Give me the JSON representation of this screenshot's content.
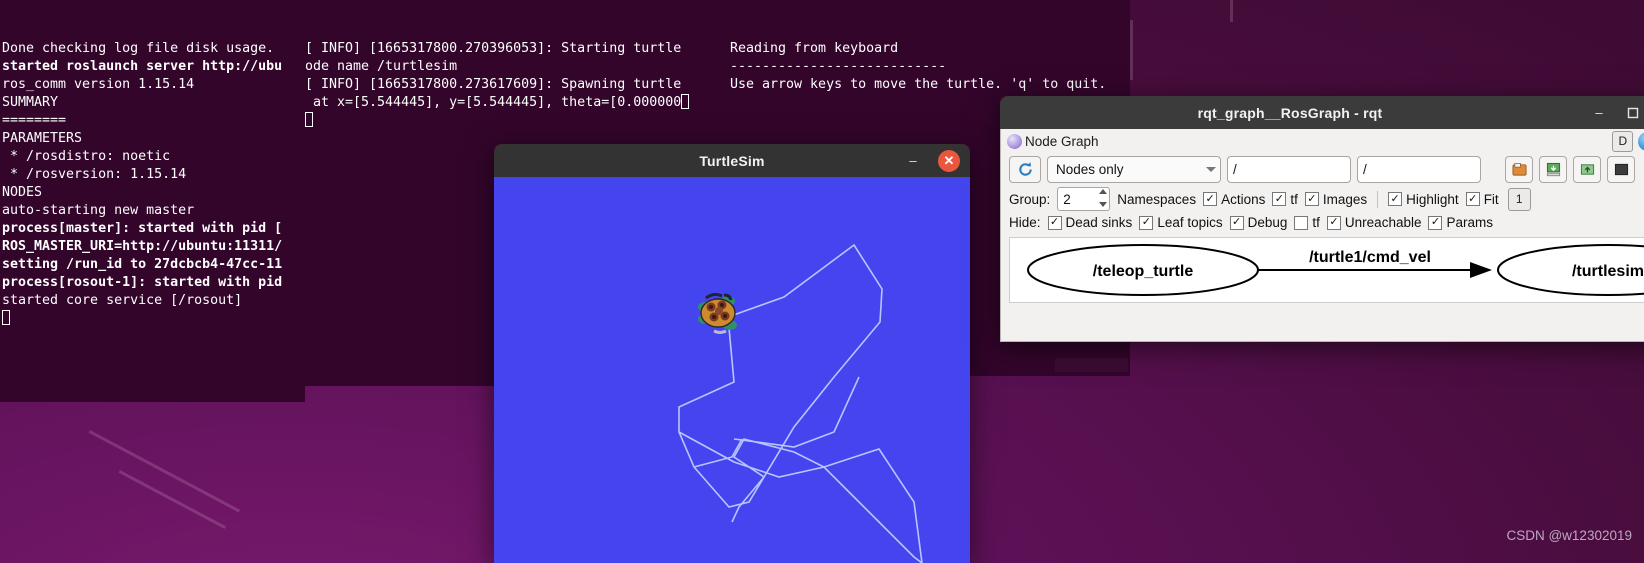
{
  "desktop": {
    "watermark": "CSDN @w12302019"
  },
  "terminals": [
    {
      "id": "roscore-terminal",
      "lines": [
        {
          "text": "Done checking log file disk usage.",
          "bold": false
        },
        {
          "text": "",
          "bold": false
        },
        {
          "text": "started roslaunch server http://ubu",
          "bold": true
        },
        {
          "text": "ros_comm version 1.15.14",
          "bold": false
        },
        {
          "text": "",
          "bold": false
        },
        {
          "text": "",
          "bold": false
        },
        {
          "text": "SUMMARY",
          "bold": false
        },
        {
          "text": "========",
          "bold": false
        },
        {
          "text": "",
          "bold": false
        },
        {
          "text": "PARAMETERS",
          "bold": false
        },
        {
          "text": " * /rosdistro: noetic",
          "bold": false
        },
        {
          "text": " * /rosversion: 1.15.14",
          "bold": false
        },
        {
          "text": "",
          "bold": false
        },
        {
          "text": "NODES",
          "bold": false
        },
        {
          "text": "",
          "bold": false
        },
        {
          "text": "auto-starting new master",
          "bold": false
        },
        {
          "text": "process[master]: started with pid [",
          "bold": true
        },
        {
          "text": "ROS_MASTER_URI=http://ubuntu:11311/",
          "bold": true
        },
        {
          "text": "",
          "bold": false
        },
        {
          "text": "setting /run_id to 27dcbcb4-47cc-11",
          "bold": true
        },
        {
          "text": "process[rosout-1]: started with pid",
          "bold": true
        },
        {
          "text": "started core service [/rosout]",
          "bold": false
        }
      ]
    },
    {
      "id": "turtlesim-node-terminal",
      "lines": [
        {
          "text": "[ INFO] [1665317800.270396053]: Starting turtle",
          "bold": false
        },
        {
          "text": "ode name /turtlesim",
          "bold": false
        },
        {
          "text": "[ INFO] [1665317800.273617609]: Spawning turtle",
          "bold": false
        },
        {
          "text": " at x=[5.544445], y=[5.544445], theta=[0.000000",
          "bold": false
        }
      ]
    },
    {
      "id": "teleop-key-terminal",
      "lines": [
        {
          "text": "Reading from keyboard",
          "bold": false
        },
        {
          "text": "---------------------------",
          "bold": false
        },
        {
          "text": "Use arrow keys to move the turtle. 'q' to quit.",
          "bold": false
        }
      ]
    }
  ],
  "turtlesim": {
    "title": "TurtleSim",
    "minimize_label": "–",
    "close_label": "✕",
    "canvas_color": "#4545f0",
    "path_color": "#b6c6ff"
  },
  "rqt": {
    "title": "rqt_graph__RosGraph - rqt",
    "minimize_label": "–",
    "maximize_label": "❑",
    "close_label": "✕",
    "dock": {
      "title": "Node Graph",
      "float_label": "D",
      "help_label": "?",
      "dash_label": "-"
    },
    "toolbar": {
      "refresh_icon": "refresh-icon",
      "graph_type": "Nodes only",
      "filter_namespace": "/",
      "filter_topic": "/",
      "save_dot_icon": "save-dot-icon",
      "save_image_icon": "save-image-icon",
      "load_icon": "load-icon",
      "fit_icon": "fit-icon"
    },
    "options": {
      "group_label": "Group:",
      "group_value": "2",
      "checks": [
        {
          "label": "Namespaces",
          "checked": true,
          "hidden_box": true
        },
        {
          "label": "Actions",
          "checked": true,
          "hidden_box": false
        },
        {
          "label": "tf",
          "checked": true,
          "hidden_box": false
        },
        {
          "label": "Images",
          "checked": true,
          "hidden_box": false
        }
      ],
      "right_checks": [
        {
          "label": "Highlight",
          "checked": true
        },
        {
          "label": "Fit",
          "checked": true
        }
      ],
      "counter_btn": "1"
    },
    "hide": {
      "label": "Hide:",
      "checks": [
        {
          "label": "Dead sinks",
          "checked": true
        },
        {
          "label": "Leaf topics",
          "checked": true
        },
        {
          "label": "Debug",
          "checked": true
        },
        {
          "label": "tf",
          "checked": false
        },
        {
          "label": "Unreachable",
          "checked": true
        },
        {
          "label": "Params",
          "checked": true
        }
      ]
    },
    "graph": {
      "node_left": "/teleop_turtle",
      "node_right": "/turtlesim",
      "edge_label": "/turtle1/cmd_vel"
    }
  }
}
